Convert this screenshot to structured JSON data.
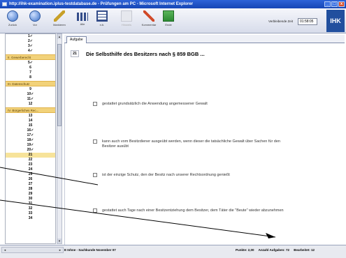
{
  "window": {
    "title": "http://ihk-examination.iplus-testdatabase.de - Prüfungen am PC - Microsoft Internet Explorer",
    "controls": [
      "_",
      "□",
      "x"
    ]
  },
  "toolbar": {
    "buttons": [
      {
        "label": "Zurück",
        "icon": "back-arrow-icon",
        "enabled": true
      },
      {
        "label": "Vor",
        "icon": "forward-arrow-icon",
        "enabled": true
      },
      {
        "label": "Markieren",
        "icon": "flag-icon",
        "enabled": true
      },
      {
        "label": "Alle",
        "icon": "grid-icon",
        "enabled": true
      },
      {
        "label": "n.b.",
        "icon": "grid-outline-icon",
        "enabled": true
      },
      {
        "label": "Hinweis",
        "icon": "hint-icon",
        "enabled": false
      },
      {
        "label": "Kommentar",
        "icon": "pen-icon",
        "enabled": true
      },
      {
        "label": "Ende",
        "icon": "exit-icon",
        "enabled": true
      }
    ],
    "time_label": "Verbleibende Zeit",
    "time_value": "01:58:05",
    "logo": "IHK"
  },
  "sidebar": {
    "items": [
      {
        "type": "q",
        "label": "1✓"
      },
      {
        "type": "q",
        "label": "2✓"
      },
      {
        "type": "q",
        "label": "3✓"
      },
      {
        "type": "q",
        "label": "4✓"
      },
      {
        "type": "section",
        "label": "II. Gewerberecht"
      },
      {
        "type": "q",
        "label": "5✓"
      },
      {
        "type": "q",
        "label": "6"
      },
      {
        "type": "q",
        "label": "7"
      },
      {
        "type": "q",
        "label": "8"
      },
      {
        "type": "section",
        "label": "III. Datenschutz"
      },
      {
        "type": "q",
        "label": "9"
      },
      {
        "type": "q",
        "label": "10✓"
      },
      {
        "type": "q",
        "label": "11✓"
      },
      {
        "type": "q",
        "label": "12"
      },
      {
        "type": "section",
        "label": "IV. Bürgerliches Rec..."
      },
      {
        "type": "q",
        "label": "13"
      },
      {
        "type": "q",
        "label": "14"
      },
      {
        "type": "q",
        "label": "15"
      },
      {
        "type": "q",
        "label": "16✓"
      },
      {
        "type": "q",
        "label": "17✓"
      },
      {
        "type": "q",
        "label": "18✓"
      },
      {
        "type": "q",
        "label": "19✓"
      },
      {
        "type": "q",
        "label": "20✓"
      },
      {
        "type": "q",
        "label": "21",
        "active": true
      },
      {
        "type": "q",
        "label": "22"
      },
      {
        "type": "q",
        "label": "23"
      },
      {
        "type": "q",
        "label": "24"
      },
      {
        "type": "q",
        "label": "25"
      },
      {
        "type": "q",
        "label": "26"
      },
      {
        "type": "q",
        "label": "27"
      },
      {
        "type": "q",
        "label": "28"
      },
      {
        "type": "q",
        "label": "29"
      },
      {
        "type": "q",
        "label": "30"
      },
      {
        "type": "q",
        "label": "31"
      },
      {
        "type": "q",
        "label": "32"
      },
      {
        "type": "q",
        "label": "33"
      },
      {
        "type": "q",
        "label": "34"
      }
    ]
  },
  "main": {
    "tab": "Aufgabe",
    "question_number": "21",
    "question_title": "Die Selbsthilfe des Besitzers nach § 859 BGB ...",
    "answers": [
      "gestattet grundsätzlich die Anwendung angemessener Gewalt",
      "kann auch vom Besitzdiener ausgeübt werden, wenn dieser die tatsächliche Gewalt über Sachen für den Besitzer ausübt",
      "ist der einzige Schutz, den der Besitz nach unserer Rechtsordnung genießt",
      "gestattet auch Tage nach einer Besitzentziehung dem Besitzer, dem Täter die \"Beute\" wieder abzunehmen"
    ]
  },
  "status": {
    "left": "E Inhne - Sachkunde November 07",
    "points": "Punkte: 2,00",
    "count": "Anzahl Aufgaben: 72",
    "done": "Bearbeitet: 12"
  },
  "colors": {
    "titlebar": "#1e50c4",
    "section_bg": "#f2d27a",
    "active_item": "#f7e39a",
    "annotation_lines": "#000000"
  }
}
